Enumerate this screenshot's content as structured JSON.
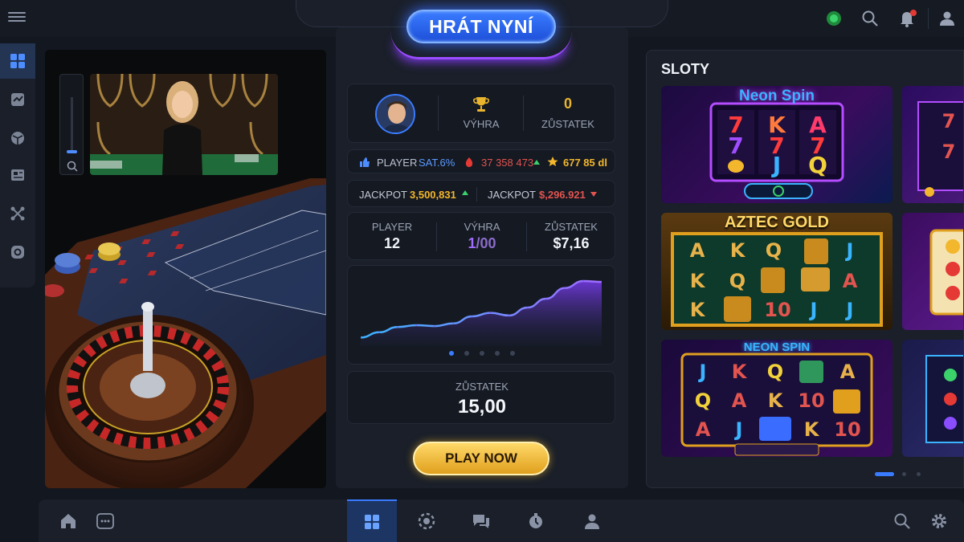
{
  "header": {
    "play_button": "HRÁT NYNÍ"
  },
  "stats": {
    "win_label": "VÝHRA",
    "balance_value": "0",
    "balance_label": "ZŮSTATEK"
  },
  "ticker": [
    {
      "label": "PLAYER",
      "value": "SAT.6%"
    },
    {
      "value": "37 358 473"
    },
    {
      "value": "677 85 dl"
    }
  ],
  "jackpots": [
    {
      "label": "JACKPOT",
      "value": "3,500,831"
    },
    {
      "label": "JACKPOT",
      "value": "$,296.921"
    }
  ],
  "summary": {
    "player_label": "PLAYER",
    "player_value": "12",
    "win_label": "VÝHRA",
    "win_value_a": "1",
    "win_value_b": "/00",
    "balance_label": "ZŮSTATEK",
    "balance_value": "$7,16"
  },
  "chart_data": {
    "type": "area",
    "values": [
      6,
      12,
      18,
      20,
      19,
      22,
      30,
      34,
      31,
      40,
      50,
      62,
      70,
      69
    ],
    "ylim": [
      0,
      80
    ],
    "color": "#8a4dff"
  },
  "carousel": {
    "count": 5,
    "active": 0
  },
  "balance_card": {
    "label": "ZŮSTATEK",
    "value": "15,00"
  },
  "play_now": "PLAY NOW",
  "slots": {
    "title": "SLOTY",
    "games": [
      {
        "name": "Neon Spin"
      },
      {
        "name": "AZTEC GOLD"
      },
      {
        "name": "NEON SPIN"
      }
    ]
  },
  "colors": {
    "accent": "#3a7cff",
    "gold": "#f2b72c",
    "purple": "#8a4dff"
  }
}
